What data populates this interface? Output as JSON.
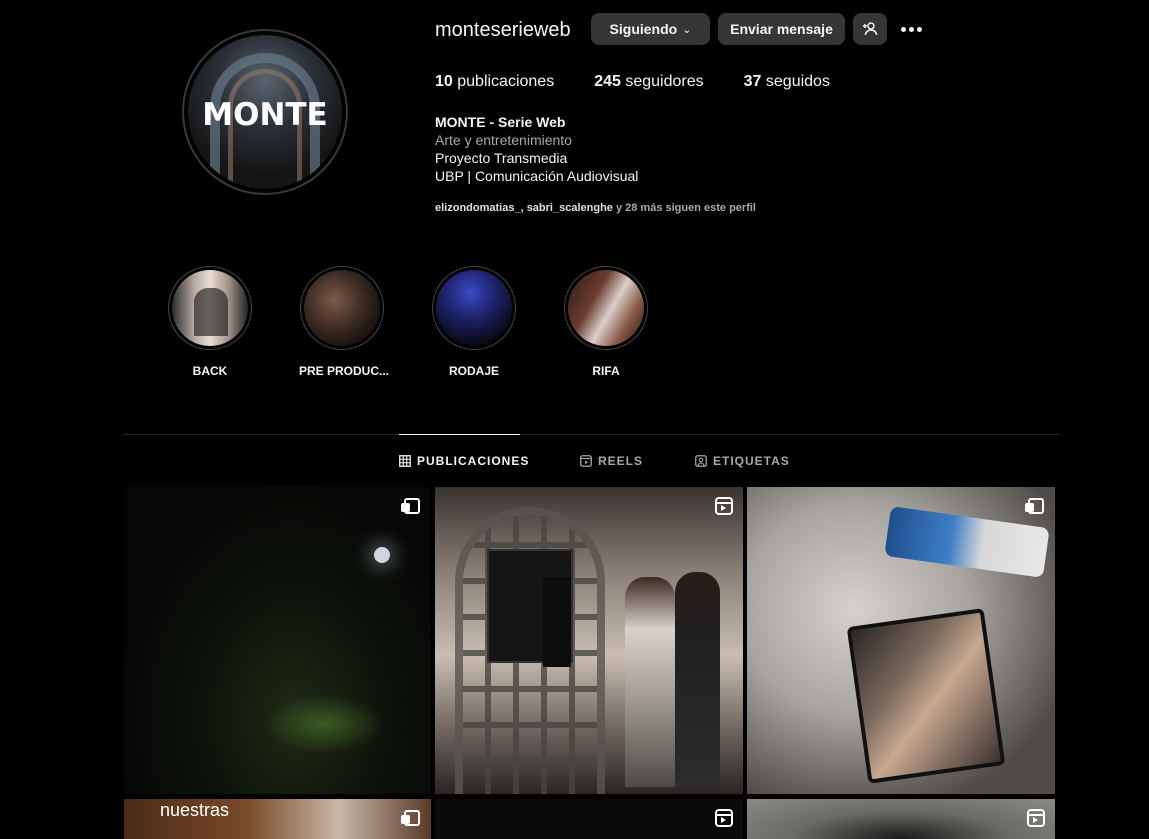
{
  "profile": {
    "username": "monteserieweb",
    "avatar_text": "MONTE",
    "buttons": {
      "following": "Siguiendo",
      "message": "Enviar mensaje",
      "add_user_icon": "person-plus-icon",
      "more_icon": "ellipsis-icon"
    },
    "stats": {
      "posts_count": "10",
      "posts_label": "publicaciones",
      "followers_count": "245",
      "followers_label": "seguidores",
      "following_count": "37",
      "following_label": "seguidos"
    },
    "bio": {
      "name": "MONTE - Serie Web",
      "category": "Arte y entretenimiento",
      "line1": "Proyecto Transmedia",
      "line2": "UBP | Comunicación Audiovisual"
    },
    "followed_by": {
      "users": "elizondomatias_, sabri_scalenghe",
      "rest": " y 28 más siguen este perfil"
    }
  },
  "highlights": [
    {
      "label": "BACK"
    },
    {
      "label": "PRE PRODUC..."
    },
    {
      "label": "RODAJE"
    },
    {
      "label": "RIFA"
    }
  ],
  "tabs": [
    {
      "label": "PUBLICACIONES",
      "icon": "grid-icon",
      "active": true
    },
    {
      "label": "REELS",
      "icon": "reels-icon",
      "active": false
    },
    {
      "label": "ETIQUETAS",
      "icon": "tagged-icon",
      "active": false
    }
  ],
  "posts": [
    {
      "type": "carousel"
    },
    {
      "type": "reel"
    },
    {
      "type": "carousel"
    },
    {
      "type": "carousel",
      "overlay_text": "nuestras"
    },
    {
      "type": "reel"
    },
    {
      "type": "reel"
    }
  ],
  "colors": {
    "background": "#000000",
    "button": "#363636",
    "muted_text": "#a8a8a8"
  }
}
